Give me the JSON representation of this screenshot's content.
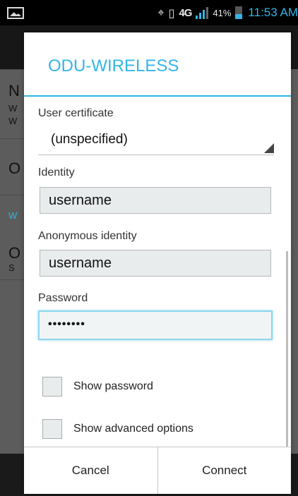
{
  "status_bar": {
    "battery_percent": "41%",
    "time": "11:53 AM",
    "network_type": "4G",
    "signal_level": 3,
    "icons": [
      "gallery-notification-icon",
      "location-icon",
      "nfc-icon",
      "lte-icon",
      "signal-icon",
      "battery-icon"
    ]
  },
  "background": {
    "row_letters": [
      "N",
      "W",
      "W",
      "O",
      "W",
      "O",
      "S"
    ]
  },
  "dialog": {
    "title": "ODU-WIRELESS",
    "user_certificate": {
      "label": "User certificate",
      "selected": "(unspecified)"
    },
    "identity": {
      "label": "Identity",
      "value": "username"
    },
    "anonymous_identity": {
      "label": "Anonymous identity",
      "value": "username"
    },
    "password": {
      "label": "Password",
      "value": "••••••••"
    },
    "show_password": {
      "label": "Show password",
      "checked": false
    },
    "show_advanced": {
      "label": "Show advanced options",
      "checked": false
    },
    "buttons": {
      "cancel": "Cancel",
      "connect": "Connect"
    }
  },
  "colors": {
    "accent": "#33b5e5",
    "focus_border": "#8ed7ef",
    "input_bg": "#e9ecec"
  }
}
